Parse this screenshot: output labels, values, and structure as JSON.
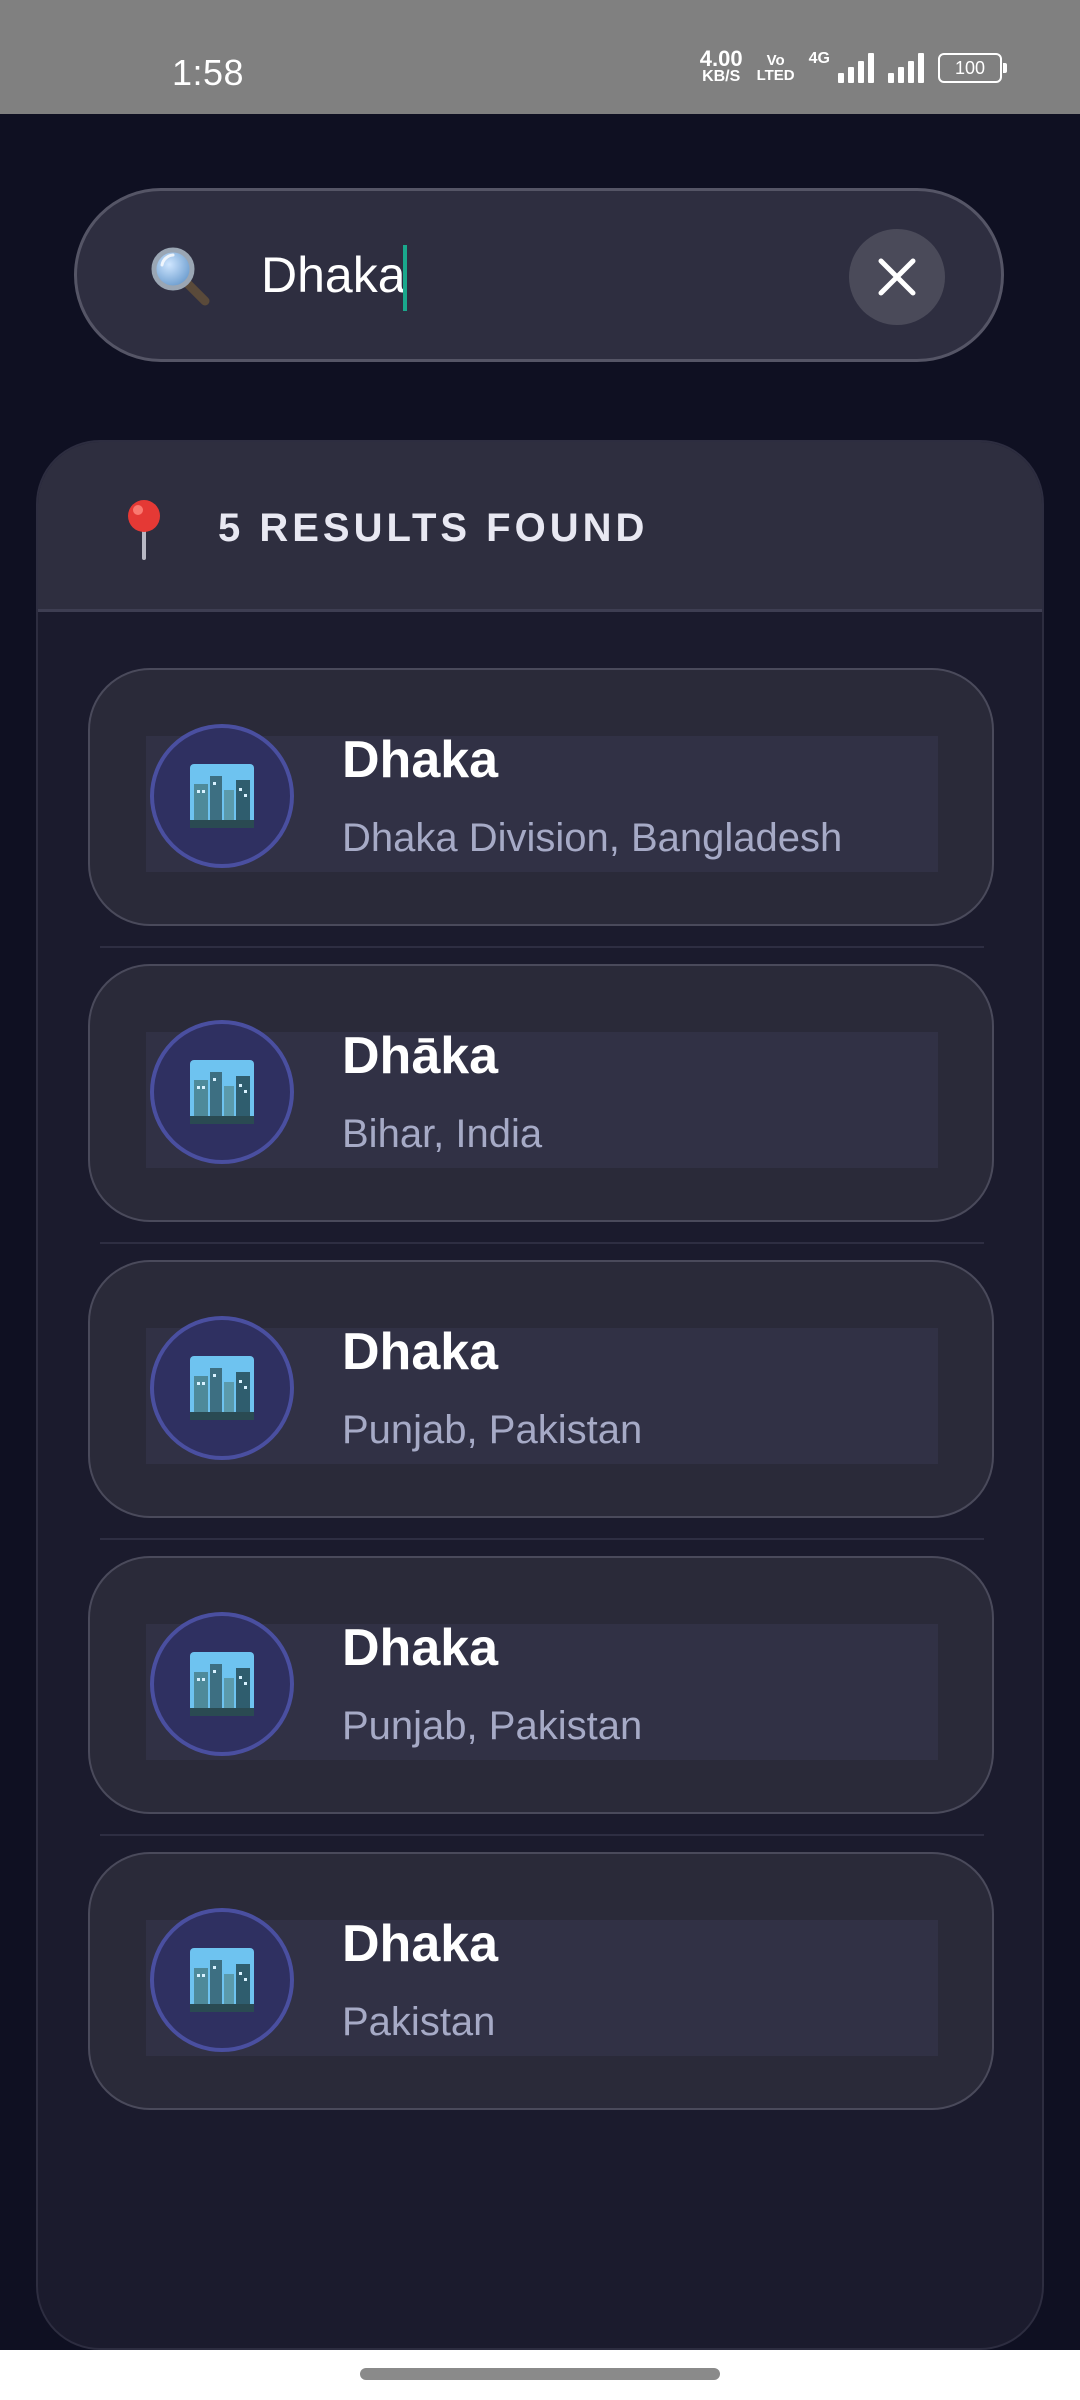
{
  "status_bar": {
    "time": "1:58",
    "net_speed_value": "4.00",
    "net_speed_unit": "KB/S",
    "volte_top": "Vo",
    "volte_bottom": "LTED",
    "network_type": "4G",
    "battery_level": "100"
  },
  "search": {
    "value": "Dhaka",
    "icon": "search-icon",
    "clear_icon": "close-icon"
  },
  "results": {
    "count_label": "5 RESULTS FOUND",
    "header_icon": "map-pin-icon",
    "items": [
      {
        "name": "Dhaka",
        "region": "Dhaka Division, Bangladesh",
        "icon": "cityscape-icon"
      },
      {
        "name": "Dhāka",
        "region": "Bihar, India",
        "icon": "cityscape-icon"
      },
      {
        "name": "Dhaka",
        "region": "Punjab, Pakistan",
        "icon": "cityscape-icon"
      },
      {
        "name": "Dhaka",
        "region": "Punjab, Pakistan",
        "icon": "cityscape-icon"
      },
      {
        "name": "Dhaka",
        "region": "Pakistan",
        "icon": "cityscape-icon"
      }
    ]
  },
  "colors": {
    "background": "#0f1022",
    "panel": "#1b1b2d",
    "card": "#2a2a39",
    "accent_cursor": "#1aa88c",
    "avatar_ring": "#4a4fa0",
    "pin": "#e53935"
  }
}
